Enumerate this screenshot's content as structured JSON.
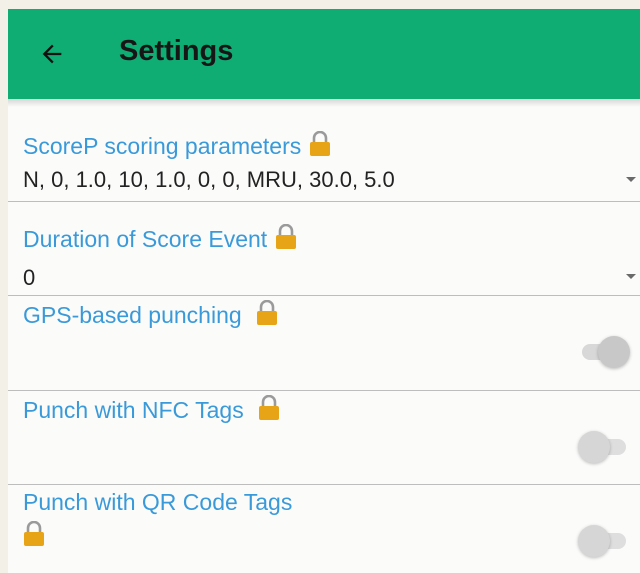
{
  "header": {
    "title": "Settings",
    "back_icon": "arrow-left-icon",
    "bar_color": "#0fac74"
  },
  "settings": [
    {
      "label": "ScoreP scoring parameters",
      "value": "N, 0, 1.0, 10, 1.0, 0, 0, MRU, 30.0, 5.0",
      "locked": true,
      "control": "dropdown"
    },
    {
      "label": "Duration of Score Event",
      "value": "0",
      "locked": true,
      "control": "dropdown"
    },
    {
      "label": "GPS-based punching",
      "locked": true,
      "control": "switch",
      "checked": true,
      "enabled": false
    },
    {
      "label": "Punch with NFC Tags",
      "locked": true,
      "control": "switch",
      "checked": false,
      "enabled": false
    },
    {
      "label": "Punch with QR Code Tags",
      "locked": true,
      "control": "switch",
      "checked": false,
      "enabled": false
    }
  ],
  "colors": {
    "label": "#3a9ad9",
    "lock": "#e8a417"
  }
}
